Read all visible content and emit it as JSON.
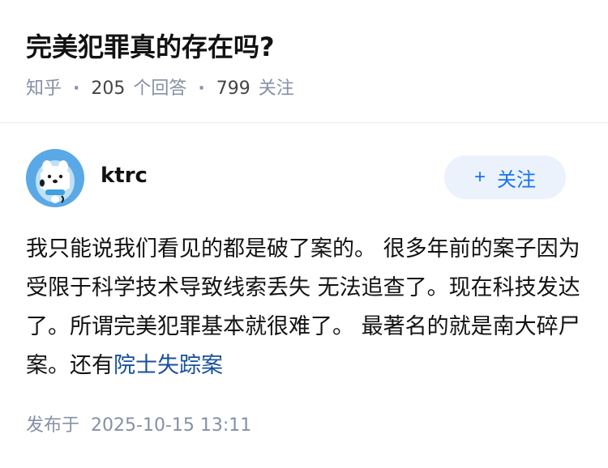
{
  "question": {
    "title": "完美犯罪真的存在吗?",
    "source": "知乎",
    "separator": "·",
    "answer_count": "205",
    "answer_label": "个回答",
    "follower_count": "799",
    "follower_label": "关注"
  },
  "author": {
    "name": "ktrc",
    "avatar_icon": "dog-avatar"
  },
  "follow_button": {
    "icon": "plus-icon",
    "plus": "+",
    "label": "关注"
  },
  "answer": {
    "text": "我只能说我们看见的都是破了案的。 很多年前的案子因为受限于科学技术导致线索丢失 无法追查了。现在科技发达了。所谓完美犯罪基本就很难了。 最著名的就是南大碎尸案。还有",
    "link_text": "院士失踪案"
  },
  "publish": {
    "label": "发布于",
    "date": "2025-10-15 13:11"
  },
  "colors": {
    "accent": "#1772f6",
    "link": "#175199",
    "meta": "#8590a6",
    "button_bg": "#ebf2fb"
  }
}
